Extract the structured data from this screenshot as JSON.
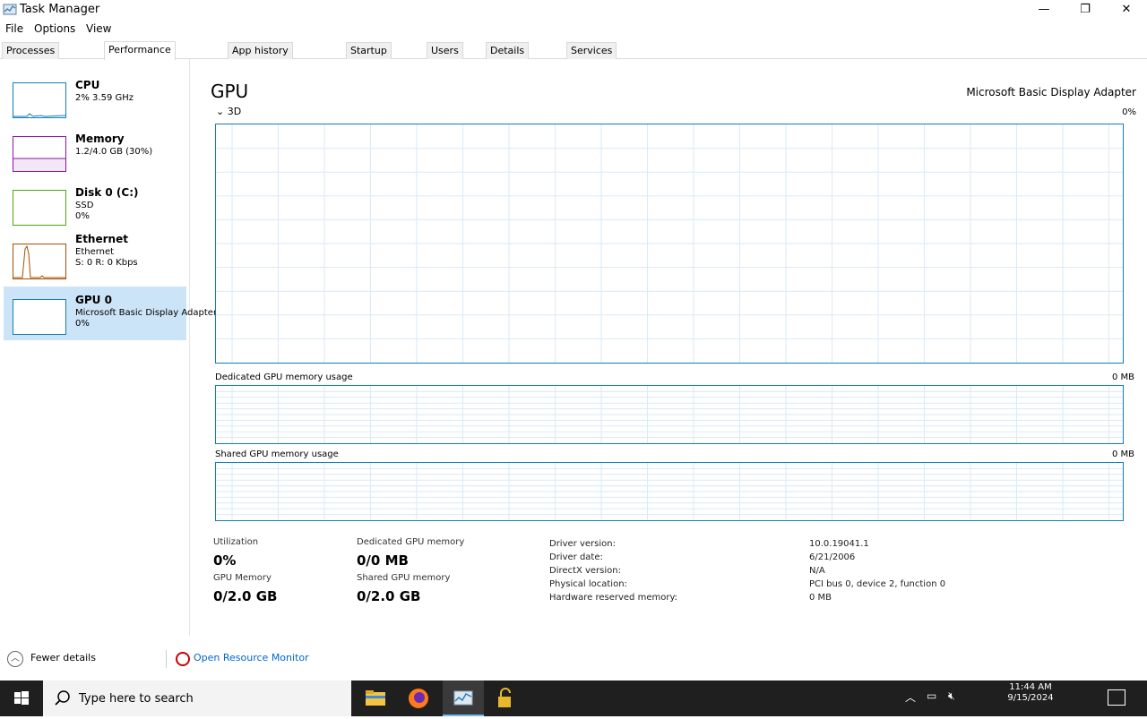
{
  "window": {
    "title": "Task Manager",
    "min_glyph": "—",
    "max_glyph": "❐",
    "close_glyph": "✕"
  },
  "menu": [
    "File",
    "Options",
    "View"
  ],
  "tabs": [
    "Processes",
    "Performance",
    "App history",
    "Startup",
    "Users",
    "Details",
    "Services"
  ],
  "active_tab": 1,
  "sidebar": {
    "items": [
      {
        "title": "CPU",
        "sub1": "2% 3.59 GHz",
        "sub2": "",
        "color": "#117dbb"
      },
      {
        "title": "Memory",
        "sub1": "1.2/4.0 GB (30%)",
        "sub2": "",
        "color": "#8b12ae"
      },
      {
        "title": "Disk 0 (C:)",
        "sub1": "SSD",
        "sub2": "0%",
        "color": "#4da60c"
      },
      {
        "title": "Ethernet",
        "sub1": "Ethernet",
        "sub2": "S: 0 R: 0 Kbps",
        "color": "#a74f01"
      },
      {
        "title": "GPU 0",
        "sub1": "Microsoft Basic Display Adapter",
        "sub2": "0%",
        "color": "#117dbb"
      }
    ],
    "selected": 4
  },
  "main": {
    "heading": "GPU",
    "heading_right": "Microsoft Basic Display Adapter",
    "subhdr": "3D",
    "subhdr_right": "0%",
    "chart1_label": "Dedicated GPU memory usage",
    "chart1_right": "0 MB",
    "chart2_label": "Shared GPU memory usage",
    "chart2_right": "0 MB"
  },
  "stats": {
    "utilization_label": "Utilization",
    "utilization_value": "0%",
    "dedicated_label": "Dedicated GPU memory",
    "dedicated_value": "0/0 MB",
    "gpu_mem_label": "GPU Memory",
    "gpu_mem_value": "0/2.0 GB",
    "shared_label": "Shared GPU memory",
    "shared_value": "0/2.0 GB",
    "list": [
      "Driver version:",
      "Driver date:",
      "DirectX version:",
      "Physical location:",
      "Hardware reserved memory:"
    ],
    "list_values": [
      "10.0.19041.1",
      "6/21/2006",
      "N/A",
      "PCI bus 0, device 2, function 0",
      "0 MB"
    ]
  },
  "footer": {
    "fewer_details": "Fewer details",
    "resource_monitor": "Open Resource Monitor"
  },
  "taskbar": {
    "search_placeholder": "Type here to search",
    "clock_time": "11:44 AM",
    "clock_date": "9/15/2024"
  }
}
